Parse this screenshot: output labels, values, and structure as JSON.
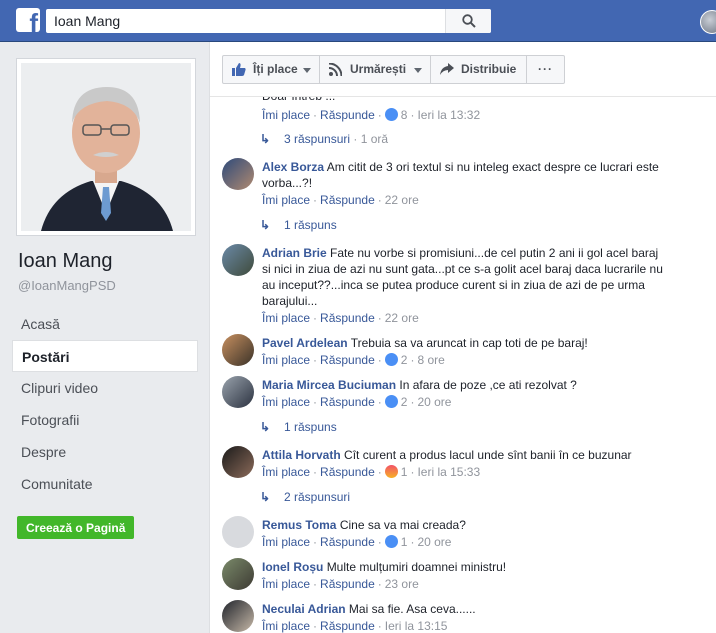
{
  "topbar": {
    "logo": "f",
    "search_value": "Ioan Mang",
    "search_icon": "search-icon"
  },
  "sidebar": {
    "name": "Ioan Mang",
    "handle": "@IoanMangPSD",
    "nav": [
      {
        "label": "Acasă"
      },
      {
        "label": "Postări"
      },
      {
        "label": "Clipuri video"
      },
      {
        "label": "Fotografii"
      },
      {
        "label": "Despre"
      },
      {
        "label": "Comunitate"
      }
    ],
    "create_page": "Creează o Pagină"
  },
  "actions": {
    "like": "Îți place",
    "follow": "Urmărești",
    "share": "Distribuie",
    "more": "···"
  },
  "comments": [
    {
      "author": "",
      "text": "Doar întreb ...",
      "like": "Îmi place",
      "reply": "Răspunde",
      "reaction": "like",
      "count": "8",
      "time": "Ieri la 13:32",
      "replies": "3 răspunsuri",
      "replies_time": "1 oră"
    },
    {
      "author": "Alex Borza",
      "text": "Am citit de 3 ori textul si nu inteleg exact despre ce lucrari este vorba...?!",
      "like": "Îmi place",
      "reply": "Răspunde",
      "time": "22 ore",
      "replies": "1 răspuns"
    },
    {
      "author": "Adrian Brie",
      "text": "Fate nu vorbe si promisiuni...de cel putin 2 ani ii gol acel baraj si nici in ziua de azi nu sunt gata...pt ce s-a golit acel baraj daca lucrarile nu au inceput??...inca se putea produce curent si in ziua de azi de pe urma barajului...",
      "like": "Îmi place",
      "reply": "Răspunde",
      "time": "22 ore"
    },
    {
      "author": "Pavel Ardelean",
      "text": "Trebuia sa va aruncat in cap toti de pe baraj!",
      "like": "Îmi place",
      "reply": "Răspunde",
      "reaction": "like",
      "count": "2",
      "time": "8 ore"
    },
    {
      "author": "Maria Mircea Buciuman",
      "text": "In afara de poze ,ce ati rezolvat ?",
      "like": "Îmi place",
      "reply": "Răspunde",
      "reaction": "like",
      "count": "2",
      "time": "20 ore",
      "replies": "1 răspuns"
    },
    {
      "author": "Attila Horvath",
      "text": "Cît curent a produs lacul unde sînt banii în ce buzunar",
      "like": "Îmi place",
      "reply": "Răspunde",
      "reaction": "angry",
      "count": "1",
      "time": "Ieri la 15:33",
      "replies": "2 răspunsuri"
    },
    {
      "author": "Remus Toma",
      "text": "Cine sa va mai creada?",
      "like": "Îmi place",
      "reply": "Răspunde",
      "reaction": "like",
      "count": "1",
      "time": "20 ore"
    },
    {
      "author": "Ionel Roșu",
      "text": "Multe mulțumiri doamnei ministru!",
      "like": "Îmi place",
      "reply": "Răspunde",
      "time": "23 ore"
    },
    {
      "author": "Neculai Adrian",
      "text": "Mai sa fie. Asa ceva......",
      "like": "Îmi place",
      "reply": "Răspunde",
      "time": "Ieri la 13:15"
    }
  ],
  "colors": {
    "brand": "#4267b2",
    "link": "#385898",
    "create_button": "#42b72a"
  }
}
